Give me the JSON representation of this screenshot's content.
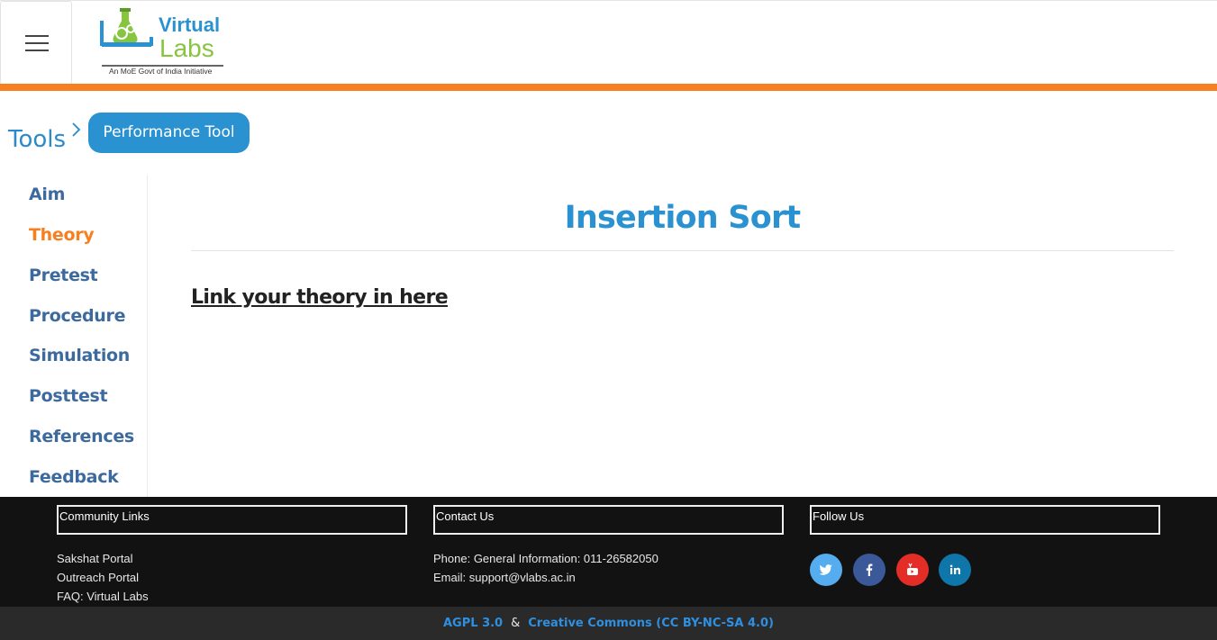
{
  "header": {
    "logo_title": "Virtual",
    "logo_subtitle": "Labs",
    "logo_tagline": "An MoE Govt of India Initiative"
  },
  "breadcrumb": {
    "root": "Tools",
    "current": "Performance Tool"
  },
  "sidebar": {
    "items": [
      {
        "label": "Aim",
        "active": false
      },
      {
        "label": "Theory",
        "active": true
      },
      {
        "label": "Pretest",
        "active": false
      },
      {
        "label": "Procedure",
        "active": false
      },
      {
        "label": "Simulation",
        "active": false
      },
      {
        "label": "Posttest",
        "active": false
      },
      {
        "label": "References",
        "active": false
      },
      {
        "label": "Feedback",
        "active": false
      }
    ]
  },
  "main": {
    "title": "Insertion Sort",
    "theory_link": "Link your theory in here"
  },
  "footer": {
    "community": {
      "heading": "Community Links",
      "links": [
        "Sakshat Portal",
        "Outreach Portal",
        "FAQ: Virtual Labs"
      ]
    },
    "contact": {
      "heading": "Contact Us",
      "phone": "Phone: General Information: 011-26582050",
      "email": "Email: support@vlabs.ac.in"
    },
    "follow": {
      "heading": "Follow Us",
      "icons": [
        "twitter-icon",
        "facebook-icon",
        "youtube-icon",
        "linkedin-icon"
      ]
    },
    "license_1": "AGPL 3.0",
    "separator": "&",
    "license_2": "Creative Commons (CC BY-NC-SA 4.0)"
  },
  "colors": {
    "accent_orange": "#f77f1f",
    "accent_blue": "#2b92d2",
    "nav_blue": "#3d6a9e",
    "twitter": "#55acee",
    "facebook": "#3b5998",
    "youtube": "#e52d27",
    "linkedin": "#0e76a8"
  }
}
